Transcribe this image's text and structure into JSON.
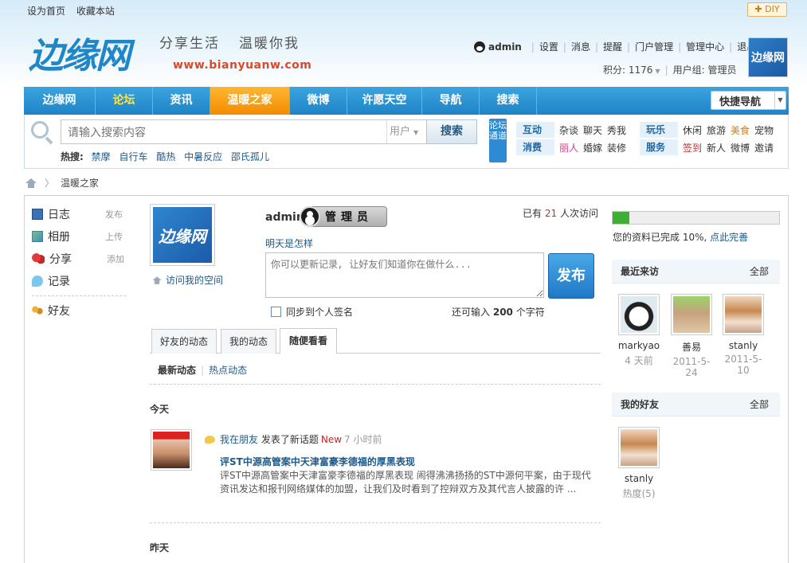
{
  "top_links": [
    "设为首页",
    "收藏本站"
  ],
  "diy_label": "DIY",
  "logo_text": "边缘网",
  "slogans": [
    "分享生活",
    "温暖你我"
  ],
  "site_url": "www.bianyuanw.com",
  "userbar": {
    "username": "admin",
    "links": [
      "设置",
      "消息",
      "提醒",
      "门户管理",
      "管理中心",
      "退出"
    ],
    "points_label": "积分: 1176",
    "group_label": "用户组: 管理员"
  },
  "user_avatar_text": "边缘网",
  "nav": {
    "items": [
      "边缘网",
      "论坛",
      "资讯",
      "温暖之家",
      "微博",
      "许愿天空",
      "导航",
      "搜索"
    ],
    "quick_nav": "快捷导航"
  },
  "search": {
    "placeholder": "请输入搜索内容",
    "scope": "用户",
    "button": "搜索",
    "hot_label": "热搜:",
    "hot_terms": [
      "禁摩",
      "自行车",
      "酷热",
      "中暑反应",
      "邵氏孤儿"
    ]
  },
  "forum_channel": "论坛通道",
  "categories": {
    "row1": {
      "cat": "互动",
      "links": [
        "杂谈",
        "聊天",
        "秀我"
      ]
    },
    "row2": {
      "cat": "消费",
      "links": [
        "丽人",
        "婚嫁",
        "装修"
      ]
    },
    "row3": {
      "cat": "玩乐",
      "links": [
        "休闲",
        "旅游",
        "美食",
        "宠物"
      ]
    },
    "row4": {
      "cat": "服务",
      "links": [
        "签到",
        "新人",
        "微博",
        "邀请"
      ]
    }
  },
  "breadcrumb": {
    "current": "温暖之家"
  },
  "sidebar": [
    {
      "label": "日志",
      "action": "发布"
    },
    {
      "label": "相册",
      "action": "上传"
    },
    {
      "label": "分享",
      "action": "添加"
    },
    {
      "label": "记录",
      "action": ""
    },
    {
      "label": "好友",
      "action": ""
    }
  ],
  "profile": {
    "avatar_text": "边缘网",
    "visit_space": "访问我的空间",
    "name": "admin",
    "badge": "管理员",
    "visits_prefix": "已有",
    "visits_count": "21",
    "visits_suffix": "人次访问",
    "mood": "明天是怎样",
    "status_placeholder": "你可以更新记录, 让好友们知道你在做什么...",
    "publish": "发布",
    "sync_label": "同步到个人签名",
    "remain_prefix": "还可输入",
    "remain_count": "200",
    "remain_suffix": "个字符"
  },
  "tabs": [
    "好友的动态",
    "我的动态",
    "随便看看"
  ],
  "subtabs": [
    "最新动态",
    "热点动态"
  ],
  "today_label": "今天",
  "yesterday_label": "昨天",
  "feed": {
    "user": "我在朋友",
    "action": "发表了新话题",
    "new": "New",
    "time": "7 小时前",
    "title": "评ST中源高管案中天津富豪李德福的厚黑表现",
    "body": "评ST中源高管案中天津富豪李德福的厚黑表现 闹得沸沸扬扬的ST中源何平案，由于现代资讯发达和报刊网络媒体的加盟，让我们及时看到了控辩双方及其代言人披露的许 ..."
  },
  "profile_progress": {
    "value": 0.1,
    "text": "您的资料已完成 10%,",
    "link": "点此完善"
  },
  "recent_visitors": {
    "title": "最近来访",
    "all": "全部",
    "items": [
      {
        "name": "markyao",
        "date": "4 天前"
      },
      {
        "name": "善易",
        "date": "2011-5-24"
      },
      {
        "name": "stanly",
        "date": "2011-5-10"
      }
    ]
  },
  "my_friends": {
    "title": "我的好友",
    "all": "全部",
    "items": [
      {
        "name": "stanly",
        "heat": "热度(5)"
      }
    ]
  }
}
